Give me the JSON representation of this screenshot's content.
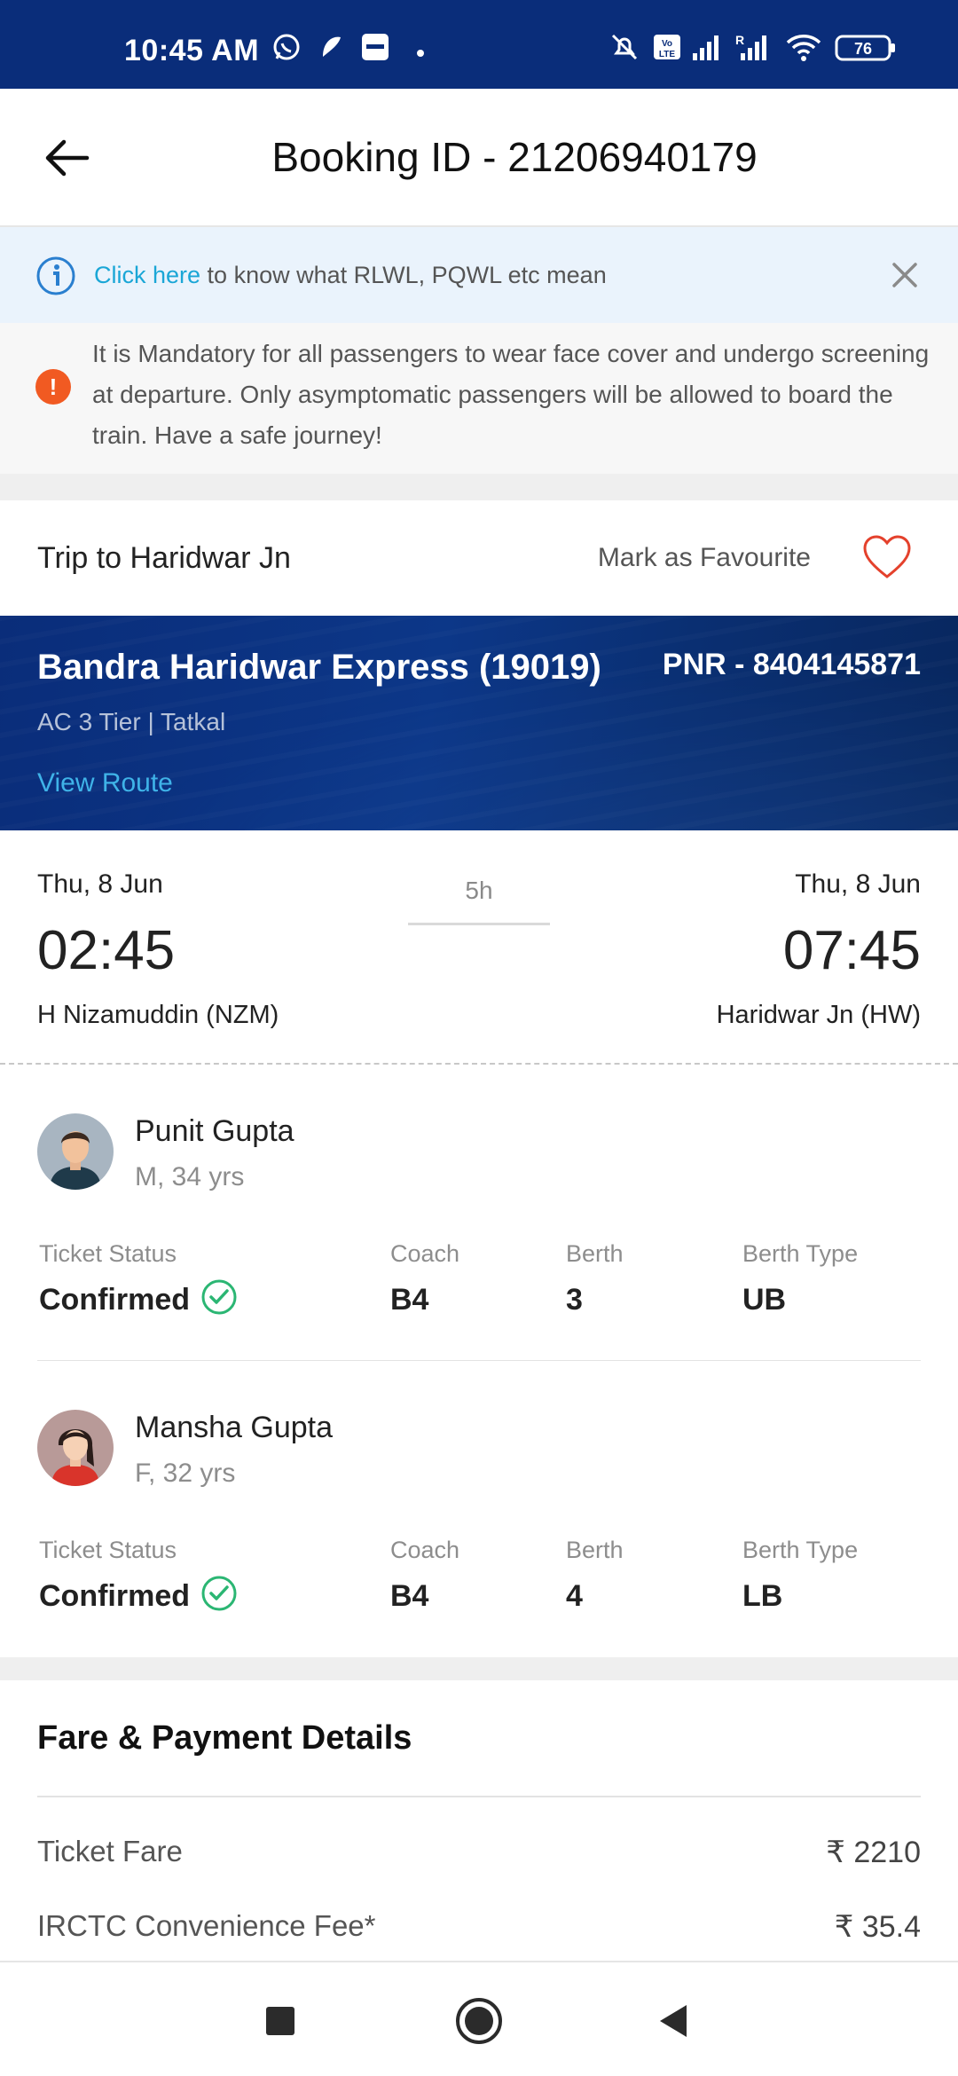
{
  "status_bar": {
    "time": "10:45 AM",
    "battery": "76",
    "icons": [
      "whatsapp-icon",
      "payments-icon",
      "paytm-icon",
      "mute-icon",
      "volte-icon",
      "signal-icon",
      "signal-roaming-icon",
      "wifi-icon",
      "battery-icon"
    ]
  },
  "header": {
    "title": "Booking ID - 21206940179"
  },
  "info_banner": {
    "link": "Click here",
    "text": " to know what RLWL, PQWL etc mean"
  },
  "notice": {
    "text": "It is Mandatory for all passengers to wear face cover and undergo screening at departure. Only asymptomatic passengers will be allowed to board the train. Have a safe journey!"
  },
  "trip": {
    "title": "Trip to Haridwar Jn",
    "favourite_label": "Mark as Favourite"
  },
  "train": {
    "name": "Bandra Haridwar Express (19019)",
    "pnr": "PNR - 8404145871",
    "class": "AC 3 Tier | Tatkal",
    "view_route": "View Route"
  },
  "journey": {
    "from": {
      "date": "Thu, 8 Jun",
      "time": "02:45",
      "station": "H Nizamuddin (NZM)"
    },
    "to": {
      "date": "Thu, 8 Jun",
      "time": "07:45",
      "station": "Haridwar Jn (HW)"
    },
    "duration": "5h"
  },
  "columns": {
    "status": "Ticket Status",
    "coach": "Coach",
    "berth": "Berth",
    "berth_type": "Berth Type"
  },
  "passengers": [
    {
      "name": "Punit Gupta",
      "meta": "M, 34 yrs",
      "status": "Confirmed",
      "coach": "B4",
      "berth": "3",
      "berth_type": "UB"
    },
    {
      "name": "Mansha Gupta",
      "meta": "F, 32 yrs",
      "status": "Confirmed",
      "coach": "B4",
      "berth": "4",
      "berth_type": "LB"
    }
  ],
  "fare": {
    "title": "Fare & Payment Details",
    "rows": [
      {
        "label": "Ticket Fare",
        "value": "₹ 2210"
      },
      {
        "label": "IRCTC Convenience Fee*",
        "value": "₹ 35.4"
      }
    ]
  },
  "colors": {
    "brand_navy": "#0a2d7a",
    "link_blue": "#1aa6d6",
    "warning_orange": "#f15a22",
    "confirm_green": "#2bb673",
    "heart_red": "#e4412c"
  }
}
